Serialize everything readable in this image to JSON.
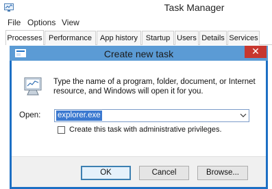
{
  "app": {
    "title": "Task Manager"
  },
  "menu": [
    {
      "label": "File"
    },
    {
      "label": "Options"
    },
    {
      "label": "View"
    }
  ],
  "tabs": [
    {
      "label": "Processes",
      "active": true
    },
    {
      "label": "Performance"
    },
    {
      "label": "App history"
    },
    {
      "label": "Startup"
    },
    {
      "label": "Users"
    },
    {
      "label": "Details"
    },
    {
      "label": "Services"
    }
  ],
  "dialog": {
    "title": "Create new task",
    "close_glyph": "✕",
    "description": "Type the name of a program, folder, document, or Internet resource, and Windows will open it for you.",
    "open_label": "Open:",
    "open_value": "explorer.exe",
    "admin_checkbox_label": "Create this task with administrative privileges.",
    "admin_checked": false,
    "buttons": {
      "ok": "OK",
      "cancel": "Cancel",
      "browse": "Browse..."
    }
  },
  "colors": {
    "accent": "#1c6fc4",
    "title_bg": "#5b9bd5",
    "close_bg": "#c7372f",
    "selection": "#3b79d0"
  },
  "icons": {
    "app": "task-manager-icon",
    "dialog": "run-dialog-icon",
    "dropdown": "chevron-down-icon",
    "close": "close-icon"
  }
}
